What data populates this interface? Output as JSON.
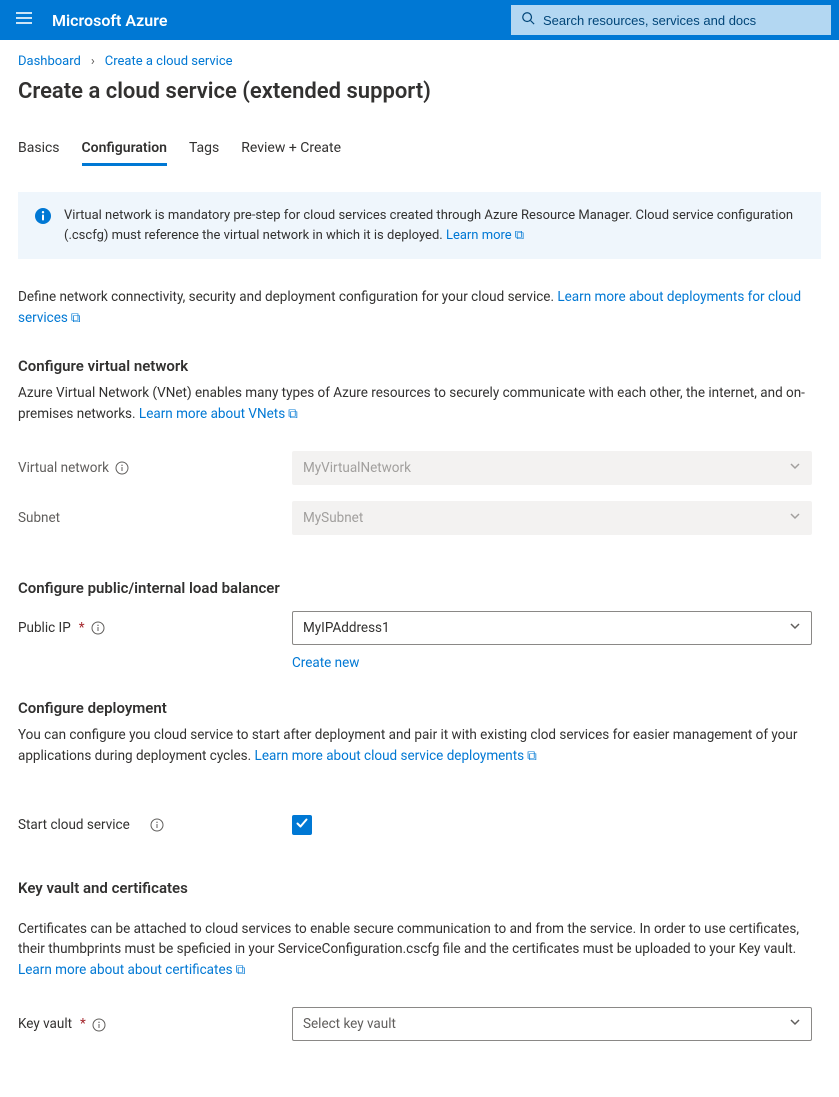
{
  "topbar": {
    "brand": "Microsoft Azure",
    "search_placeholder": "Search resources, services and docs"
  },
  "breadcrumb": {
    "items": [
      "Dashboard",
      "Create a cloud service"
    ]
  },
  "page_title": "Create a cloud service (extended support)",
  "tabs": {
    "items": [
      "Basics",
      "Configuration",
      "Tags",
      "Review + Create"
    ],
    "active_index": 1
  },
  "infobox": {
    "message_pre": "Virtual network is mandatory pre-step for cloud services created through Azure Resource Manager. Cloud service configuration (.cscfg) must reference the virtual network in which it is deployed. ",
    "link_text": "Learn more"
  },
  "intro": {
    "text": "Define network connectivity, security and deployment configuration for your cloud service. ",
    "link_text": "Learn more about deployments for cloud services"
  },
  "vnet": {
    "heading": "Configure virtual network",
    "desc_pre": "Azure Virtual Network (VNet) enables many types of Azure resources to securely communicate with each other, the internet, and on-premises networks. ",
    "desc_link": "Learn more about VNets",
    "label_vnet": "Virtual network",
    "value_vnet": "MyVirtualNetwork",
    "label_subnet": "Subnet",
    "value_subnet": "MySubnet"
  },
  "lb": {
    "heading": "Configure public/internal load balancer",
    "label_public_ip": "Public IP",
    "value_public_ip": "MyIPAddress1",
    "create_new": "Create new"
  },
  "deploy": {
    "heading": "Configure deployment",
    "desc_pre": "You can configure you cloud service to start after deployment and pair it with existing clod services for easier management of your applications during deployment cycles. ",
    "desc_link": "Learn more about cloud service deployments",
    "label_start": "Start cloud service"
  },
  "kv": {
    "heading": "Key vault and certificates",
    "desc_pre": "Certificates can be attached to cloud services to enable secure communication to and from the service. In order to use certificates, their thumbprints must be speficied in your ServiceConfiguration.cscfg file and the certificates must be uploaded to your Key vault. ",
    "desc_link": "Learn more about about certificates",
    "label_kv": "Key vault",
    "placeholder_kv": "Select key vault"
  }
}
